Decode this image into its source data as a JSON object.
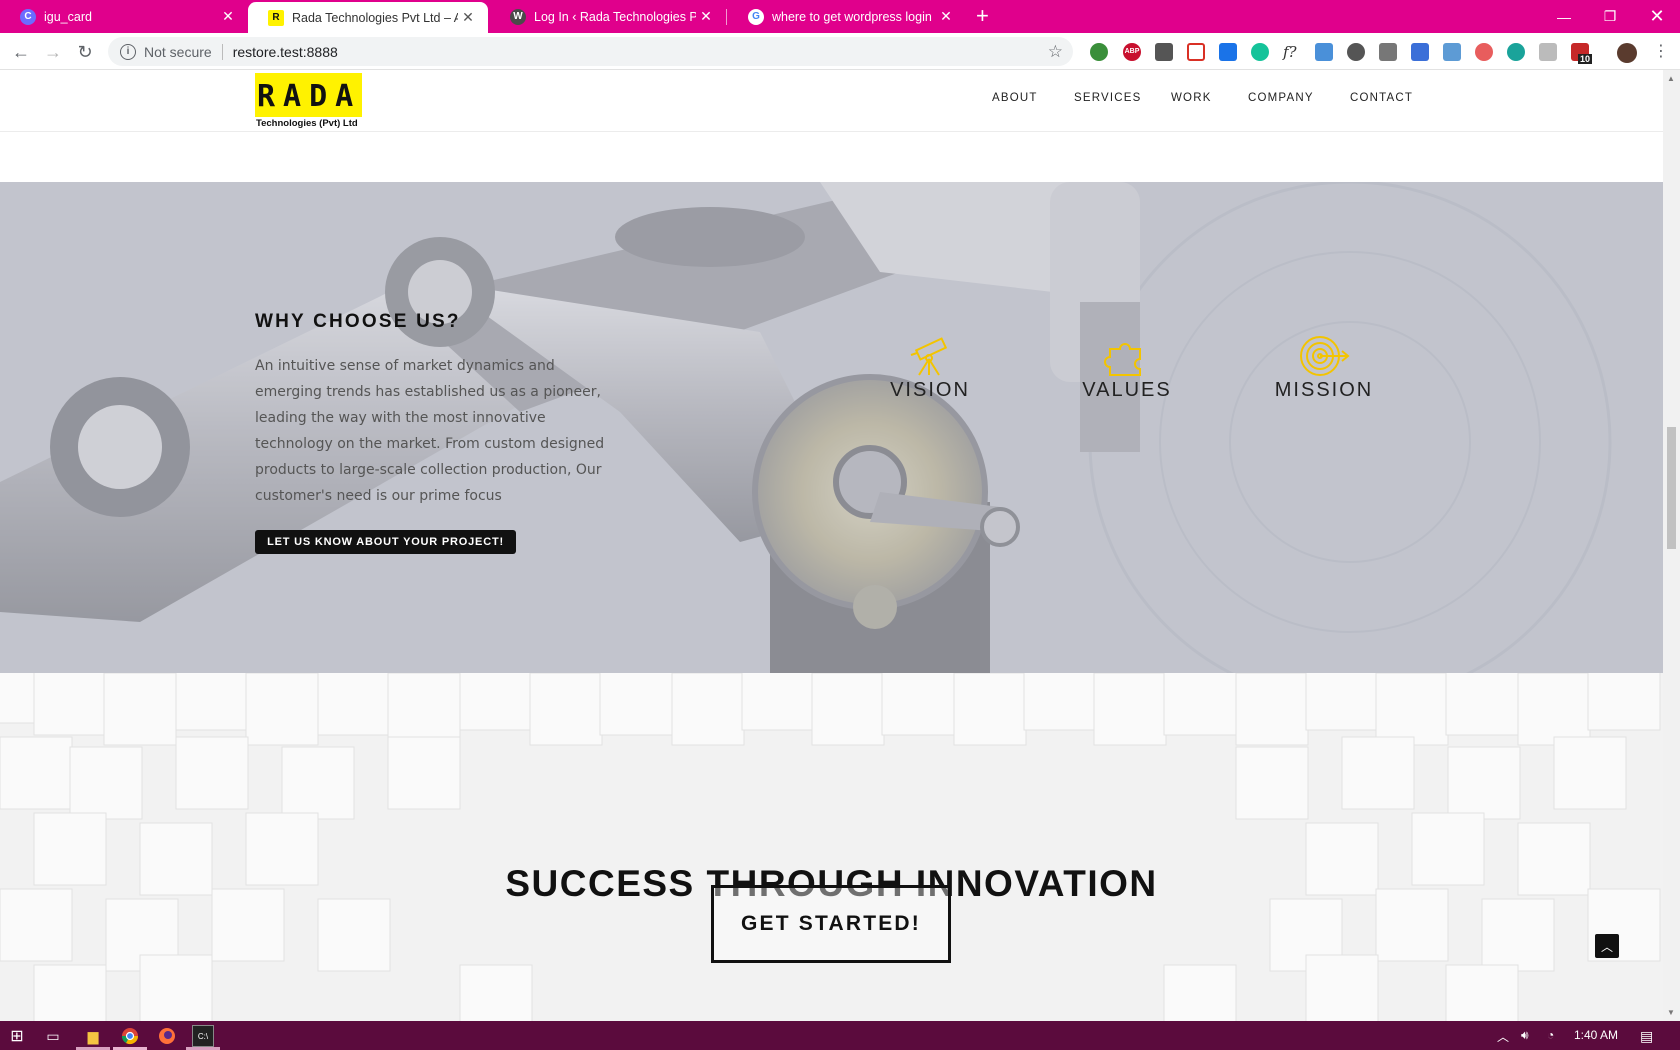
{
  "browser": {
    "tabs": [
      {
        "title": "igu_card",
        "active": false,
        "favicon": "c-circle-icon"
      },
      {
        "title": "Rada Technologies Pvt Ltd – Auto",
        "active": true,
        "favicon": "r-logo-icon"
      },
      {
        "title": "Log In ‹ Rada Technologies Pvt Lt",
        "active": false,
        "favicon": "wordpress-icon"
      },
      {
        "title": "where to get wordpress login pa",
        "active": false,
        "favicon": "google-icon"
      }
    ],
    "security_label": "Not secure",
    "url": "restore.test:8888",
    "extension_badge": "10",
    "accent": "#e0008c"
  },
  "site": {
    "logo": {
      "letters": "RADA",
      "subtitle": "Technologies (Pvt) Ltd"
    },
    "nav": [
      "ABOUT",
      "SERVICES",
      "WORK",
      "COMPANY",
      "CONTACT"
    ]
  },
  "why": {
    "title": "WHY CHOOSE US?",
    "text": "An intuitive sense of market dynamics and emerging trends has established us as a pioneer, leading the way with the most innovative technology on the market. From custom designed products to large-scale collection production, Our customer's need is our prime focus",
    "cta": "LET US KNOW ABOUT YOUR PROJECT!"
  },
  "features": [
    {
      "label": "VISION",
      "icon": "telescope-icon"
    },
    {
      "label": "VALUES",
      "icon": "puzzle-icon"
    },
    {
      "label": "MISSION",
      "icon": "target-icon"
    }
  ],
  "feature_icon_color": "#f3c400",
  "success": {
    "title": "SUCCESS THROUGH INNOVATION",
    "cta": "GET STARTED!"
  },
  "taskbar": {
    "time": "1:40 AM"
  }
}
